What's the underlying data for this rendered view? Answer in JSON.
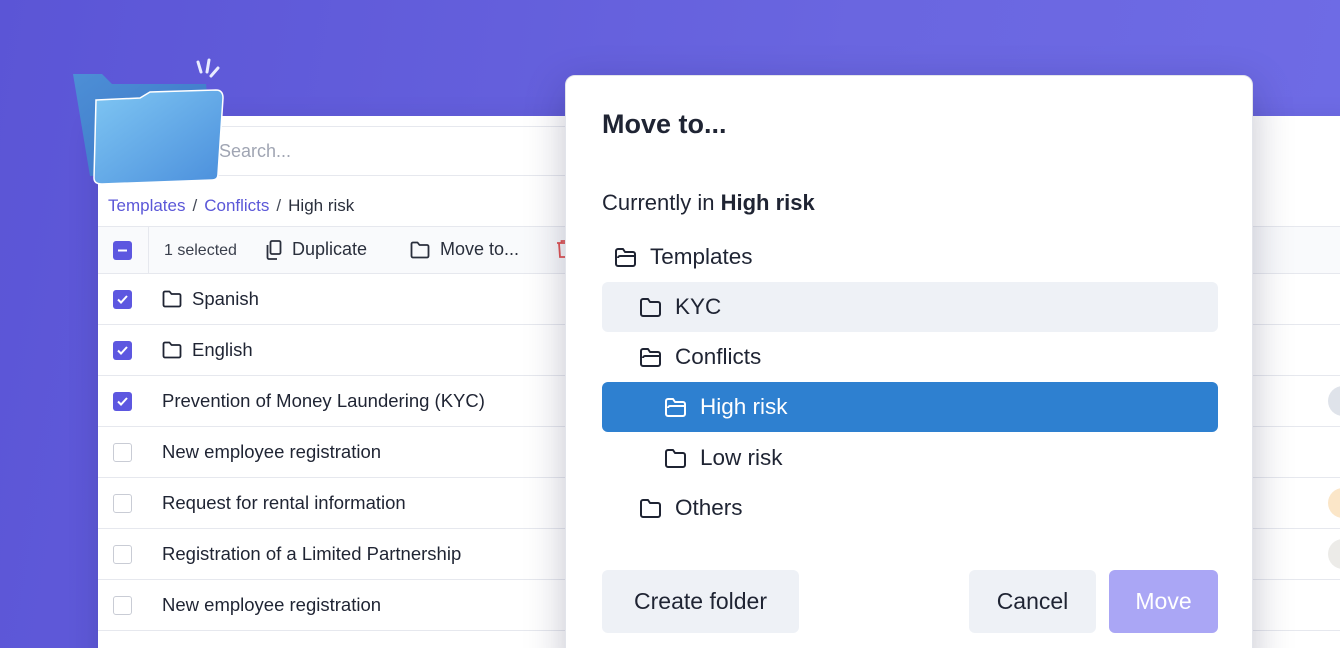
{
  "search": {
    "placeholder": "Search..."
  },
  "breadcrumb": {
    "items": [
      "Templates",
      "Conflicts",
      "High risk"
    ],
    "separator": "/"
  },
  "toolbar": {
    "selected_text": "1 selected",
    "duplicate_label": "Duplicate",
    "move_label": "Move to..."
  },
  "rows": [
    {
      "label": "Spanish",
      "type": "folder",
      "checked": true
    },
    {
      "label": "English",
      "type": "folder",
      "checked": true
    },
    {
      "label": "Prevention of Money Laundering (KYC)",
      "type": "template",
      "checked": true
    },
    {
      "label": "New employee registration",
      "type": "template",
      "checked": false
    },
    {
      "label": "Request for rental information",
      "type": "template",
      "checked": false
    },
    {
      "label": "Registration of a Limited Partnership",
      "type": "template",
      "checked": false
    },
    {
      "label": "New employee registration",
      "type": "template",
      "checked": false
    }
  ],
  "modal": {
    "title": "Move to...",
    "current_prefix": "Currently in ",
    "current_folder": "High risk",
    "tree": [
      {
        "label": "Templates",
        "depth": 0,
        "open": true,
        "state": "normal"
      },
      {
        "label": "KYC",
        "depth": 1,
        "open": false,
        "state": "hover"
      },
      {
        "label": "Conflicts",
        "depth": 1,
        "open": true,
        "state": "normal"
      },
      {
        "label": "High risk",
        "depth": 2,
        "open": true,
        "state": "selected"
      },
      {
        "label": "Low risk",
        "depth": 2,
        "open": false,
        "state": "normal"
      },
      {
        "label": "Others",
        "depth": 1,
        "open": false,
        "state": "normal"
      }
    ],
    "create_folder_label": "Create folder",
    "cancel_label": "Cancel",
    "move_label": "Move"
  },
  "colors": {
    "background": "#5b55d6",
    "accent": "#5d57e0",
    "selected_row": "#2e80d0",
    "move_disabled": "#aaa6f5",
    "link": "#5b57d8"
  }
}
